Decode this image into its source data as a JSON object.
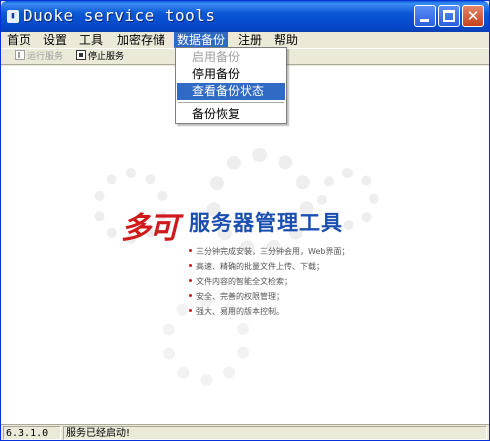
{
  "window": {
    "title": "Duoke service tools"
  },
  "menubar": {
    "items": [
      {
        "label": "首页"
      },
      {
        "label": "设置"
      },
      {
        "label": "工具"
      },
      {
        "label": "加密存储"
      },
      {
        "label": "数据备份",
        "active": true
      },
      {
        "label": "注册"
      },
      {
        "label": "帮助"
      }
    ]
  },
  "toolbar": {
    "run_service": {
      "label": "运行服务",
      "enabled": false
    },
    "stop_service": {
      "label": "停止服务",
      "enabled": true
    }
  },
  "dropdown": {
    "items": [
      {
        "label": "启用备份",
        "enabled": false
      },
      {
        "label": "停用备份",
        "enabled": true
      },
      {
        "label": "查看备份状态",
        "enabled": true,
        "selected": true
      },
      {
        "label": "备份恢复",
        "enabled": true
      }
    ]
  },
  "splash": {
    "brand_mark": "多可",
    "brand_title": "服务器管理工具",
    "features": [
      "三分钟完成安装，三分钟会用，Web界面；",
      "高速、精确的批量文件上传、下载；",
      "文件内容的智能全文检索；",
      "安全、完善的权限管理；",
      "强大、易用的版本控制。"
    ]
  },
  "statusbar": {
    "version": "6.3.1.0",
    "message": "服务已经启动!"
  },
  "colors": {
    "titlebar": "#0a58d6",
    "selection": "#316ac5",
    "brand_red": "#d0191b",
    "brand_blue": "#1a4fb0"
  }
}
